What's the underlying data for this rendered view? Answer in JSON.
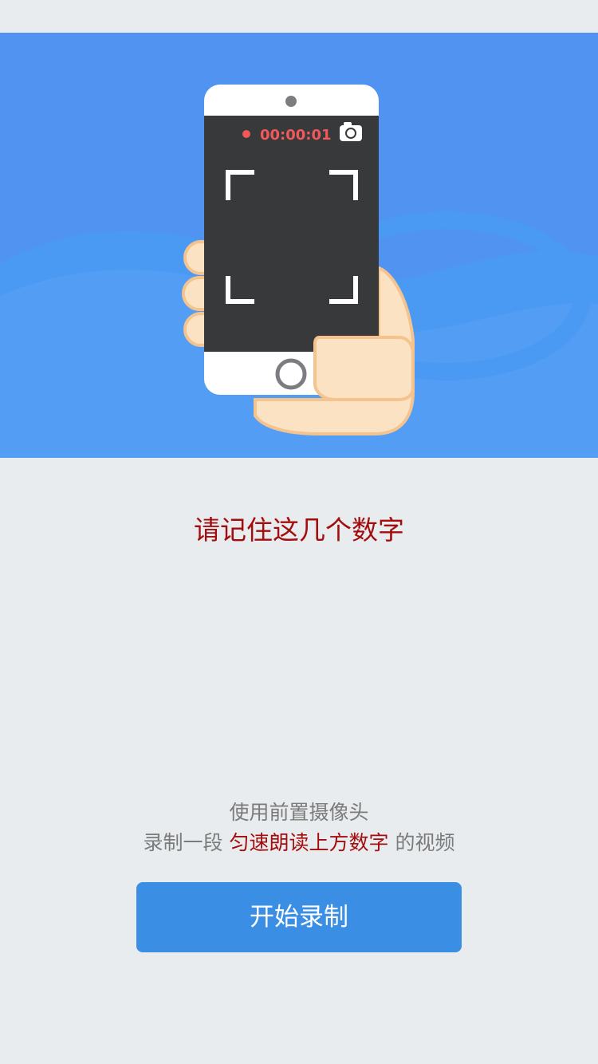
{
  "hero": {
    "icon": "phone-recording-illustration",
    "timer": "00:00:01",
    "colors": {
      "background": "#5093f1",
      "wave": "#4a9af4",
      "screen": "#38393b",
      "record_dot": "#f0585a",
      "skin": "#fae2c3",
      "skin_outline": "#f5c48e"
    }
  },
  "prompt": {
    "title": "请记住这几个数字",
    "title_color": "#a40d0e"
  },
  "instructions": {
    "line1": "使用前置摄像头",
    "line2_prefix": "录制一段 ",
    "line2_highlight": "匀速朗读上方数字",
    "line2_suffix": " 的视频"
  },
  "start_button": {
    "label": "开始录制",
    "color": "#3a8fe4"
  }
}
